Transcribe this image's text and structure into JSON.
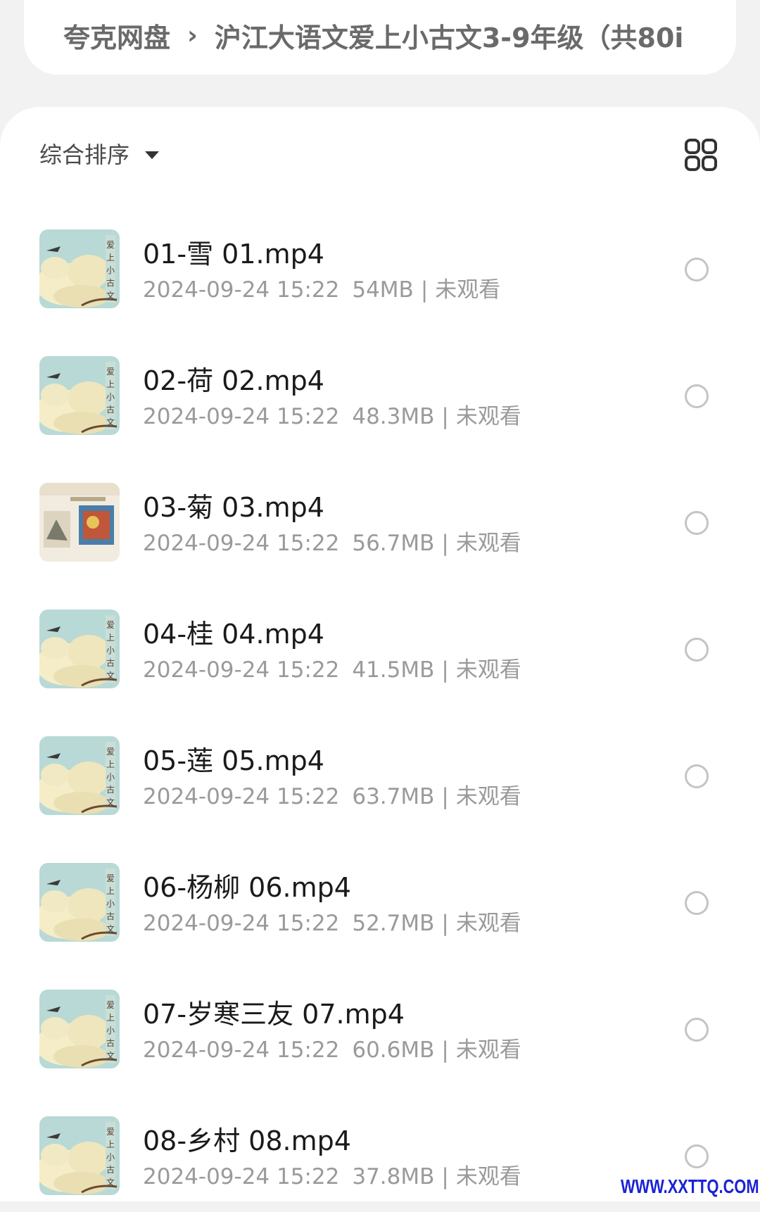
{
  "breadcrumb": {
    "root": "夸克网盘",
    "current": "沪江大语文爱上小古文3-9年级（共80i"
  },
  "toolbar": {
    "sort_label": "综合排序"
  },
  "icons": {
    "sort_caret": "caret-down-icon",
    "view_toggle": "grid-view-icon",
    "chevron": "chevron-right-icon"
  },
  "colors": {
    "name_text": "#1a1a1a",
    "meta_text": "#9a9a9a",
    "watermark": "#1a22d6"
  },
  "files": [
    {
      "name": "01-雪 01.mp4",
      "date": "2024-09-24 15:22",
      "size": "54MB",
      "status": "未观看",
      "thumb": "cover-a"
    },
    {
      "name": "02-荷 02.mp4",
      "date": "2024-09-24 15:22",
      "size": "48.3MB",
      "status": "未观看",
      "thumb": "cover-a"
    },
    {
      "name": "03-菊 03.mp4",
      "date": "2024-09-24 15:22",
      "size": "56.7MB",
      "status": "未观看",
      "thumb": "cover-b"
    },
    {
      "name": "04-桂 04.mp4",
      "date": "2024-09-24 15:22",
      "size": "41.5MB",
      "status": "未观看",
      "thumb": "cover-a"
    },
    {
      "name": "05-莲 05.mp4",
      "date": "2024-09-24 15:22",
      "size": "63.7MB",
      "status": "未观看",
      "thumb": "cover-a"
    },
    {
      "name": "06-杨柳 06.mp4",
      "date": "2024-09-24 15:22",
      "size": "52.7MB",
      "status": "未观看",
      "thumb": "cover-a"
    },
    {
      "name": "07-岁寒三友 07.mp4",
      "date": "2024-09-24 15:22",
      "size": "60.6MB",
      "status": "未观看",
      "thumb": "cover-a"
    },
    {
      "name": "08-乡村 08.mp4",
      "date": "2024-09-24 15:22",
      "size": "37.8MB",
      "status": "未观看",
      "thumb": "cover-a"
    }
  ],
  "watermark": "WWW.XXTTQ.COM"
}
